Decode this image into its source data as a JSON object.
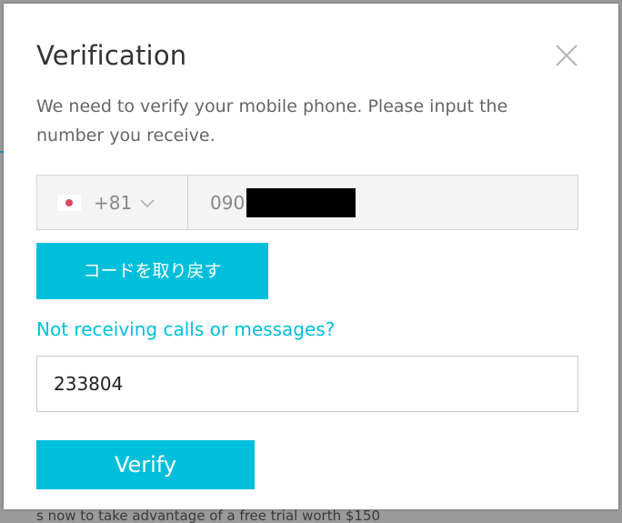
{
  "dialog": {
    "title": "Verification",
    "description": "We need to verify your mobile phone. Please input the number you receive."
  },
  "phone": {
    "country_flag": "japan-flag-icon",
    "country_code": "+81",
    "number_prefix": "090"
  },
  "buttons": {
    "get_code_label": "コードを取り戻す",
    "verify_label": "Verify"
  },
  "links": {
    "not_receiving": "Not receiving calls or messages?"
  },
  "code_field": {
    "value": "233804"
  },
  "background": {
    "bottom_text": "s now to take advantage of a free trial worth $150"
  },
  "colors": {
    "accent": "#00bfdb",
    "title": "#333333",
    "muted_text": "#666666",
    "field_bg": "#f4f4f4"
  }
}
